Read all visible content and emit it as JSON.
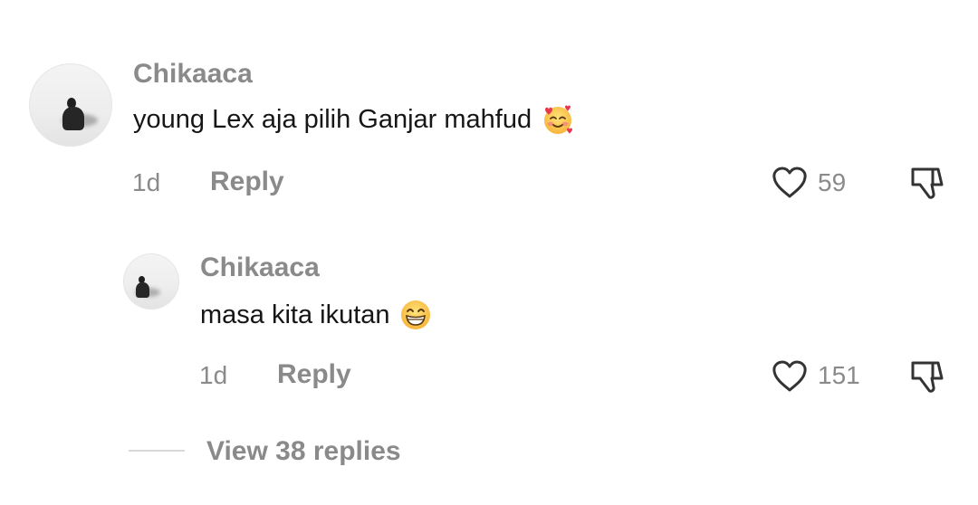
{
  "comments": [
    {
      "username": "Chikaaca",
      "text": "young Lex aja pilih Ganjar mahfud",
      "emoji": "smiling-face-with-hearts",
      "time": "1d",
      "reply_label": "Reply",
      "likes": "59"
    }
  ],
  "replies": [
    {
      "username": "Chikaaca",
      "text": "masa kita ikutan",
      "emoji": "grinning-face-with-smiling-eyes",
      "time": "1d",
      "reply_label": "Reply",
      "likes": "151"
    }
  ],
  "view_replies_label": "View 38 replies",
  "colors": {
    "muted_text": "#8a8a8a",
    "body_text": "#161616",
    "divider": "#d9d9d9"
  },
  "icons": [
    "heart-icon",
    "dislike-icon"
  ]
}
